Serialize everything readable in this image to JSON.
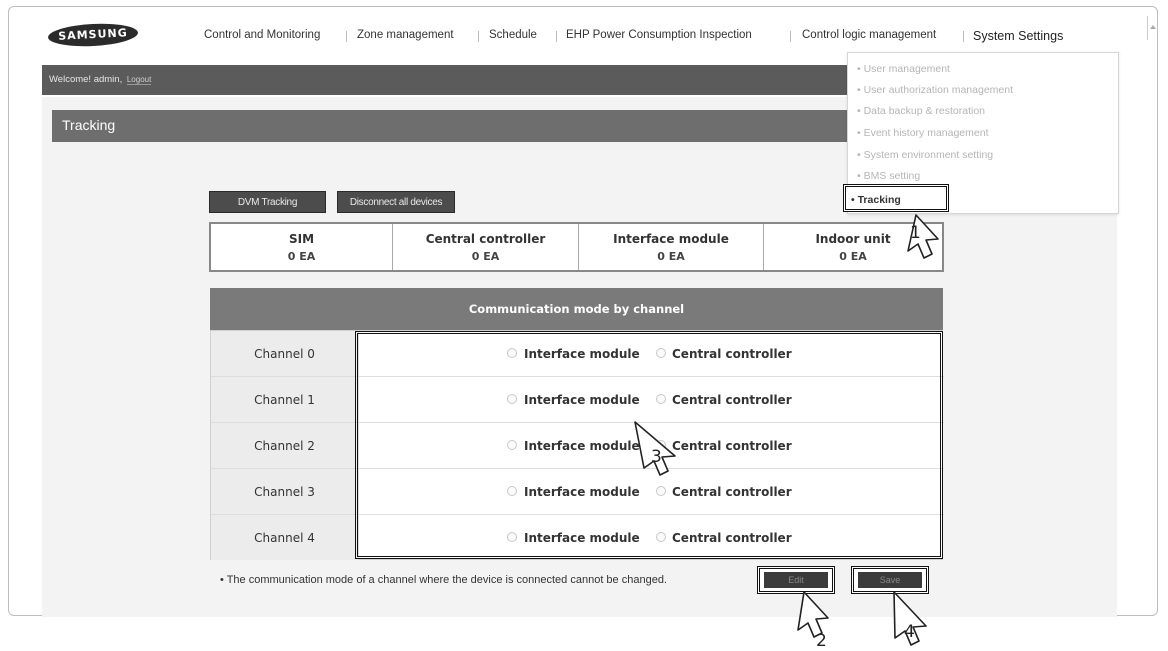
{
  "app": {
    "logo_text": "SAMSUNG"
  },
  "nav": {
    "items": [
      {
        "label": "Control and Monitoring"
      },
      {
        "label": "Zone management"
      },
      {
        "label": "Schedule"
      },
      {
        "label": "EHP Power Consumption Inspection"
      },
      {
        "label": "Control logic management"
      },
      {
        "label": "System Settings"
      }
    ]
  },
  "welcome": {
    "greeting": "Welcome! admin,",
    "user_link": "Logout"
  },
  "page": {
    "title": "Tracking"
  },
  "dropdown": {
    "items": [
      "User management",
      "User authorization management",
      "Data backup & restoration",
      "Event history management",
      "System environment setting",
      "BMS setting",
      "Tracking"
    ]
  },
  "toolbar": {
    "dvm_tracking": "DVM Tracking",
    "disconnect_all": "Disconnect all devices"
  },
  "counts": [
    {
      "name": "SIM",
      "value": "0 EA"
    },
    {
      "name": "Central controller",
      "value": "0 EA"
    },
    {
      "name": "Interface module",
      "value": "0 EA"
    },
    {
      "name": "Indoor unit",
      "value": "0 EA"
    }
  ],
  "channels": {
    "header": "Communication mode by channel",
    "option_a": "Interface module",
    "option_b": "Central controller",
    "rows": [
      {
        "label": "Channel 0"
      },
      {
        "label": "Channel 1"
      },
      {
        "label": "Channel 2"
      },
      {
        "label": "Channel 3"
      },
      {
        "label": "Channel 4"
      }
    ]
  },
  "note": "• The communication mode of a channel where the device is connected cannot be changed.",
  "actions": {
    "edit": "Edit",
    "save": "Save"
  },
  "markers": [
    "1",
    "2",
    "3",
    "4"
  ]
}
